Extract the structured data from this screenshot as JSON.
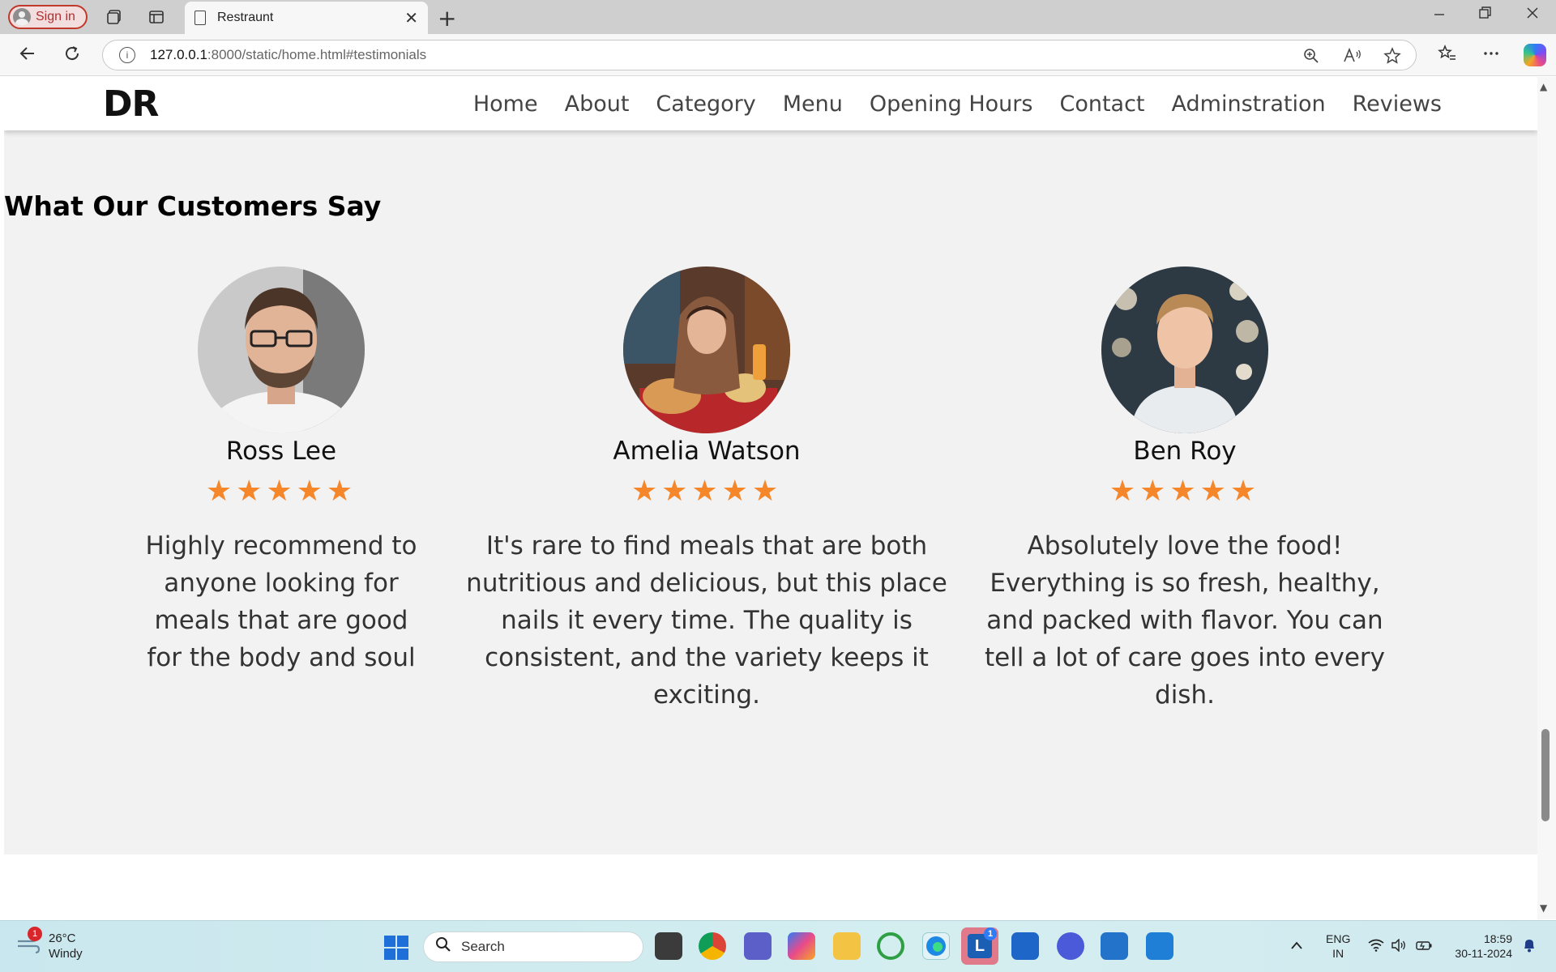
{
  "browser": {
    "signin_label": "Sign in",
    "tab_title": "Restraunt",
    "tab_close": "✕",
    "new_tab": "+",
    "url_host": "127.0.0.1",
    "url_path": ":8000/static/home.html#testimonials",
    "info_glyph": "i"
  },
  "site": {
    "logo": "DR",
    "nav": [
      "Home",
      "About",
      "Category",
      "Menu",
      "Opening Hours",
      "Contact",
      "Adminstration",
      "Reviews"
    ]
  },
  "testimonials": {
    "title": "What Our Customers Say",
    "cards": [
      {
        "name": "Ross Lee",
        "stars": "★★★★★",
        "rating": 5,
        "quote_lines": [
          "Highly recommend to",
          "anyone looking for",
          "meals that are good",
          "for the body and soul"
        ]
      },
      {
        "name": "Amelia Watson",
        "stars": "★★★★★",
        "rating": 5,
        "quote_lines": [
          "It's rare to find meals that are both",
          "nutritious and delicious, but this place",
          "nails it every time. The quality is",
          "consistent, and the variety keeps it",
          "exciting."
        ]
      },
      {
        "name": "Ben Roy",
        "stars": "★★★★★",
        "rating": 5,
        "quote_lines": [
          "Absolutely love the food!",
          "Everything is so fresh, healthy,",
          "and packed with flavor. You can",
          "tell a lot of care goes into every",
          "dish."
        ]
      }
    ]
  },
  "taskbar": {
    "weather_badge": "1",
    "temperature": "26°C",
    "condition": "Windy",
    "search_placeholder": "Search",
    "lang_top": "ENG",
    "lang_bottom": "IN",
    "time": "18:59",
    "date": "30-11-2024",
    "app_badge": "1"
  },
  "colors": {
    "star": "#f5862a",
    "page_bg": "#f2f2f2",
    "signin_border": "#c0392b"
  }
}
